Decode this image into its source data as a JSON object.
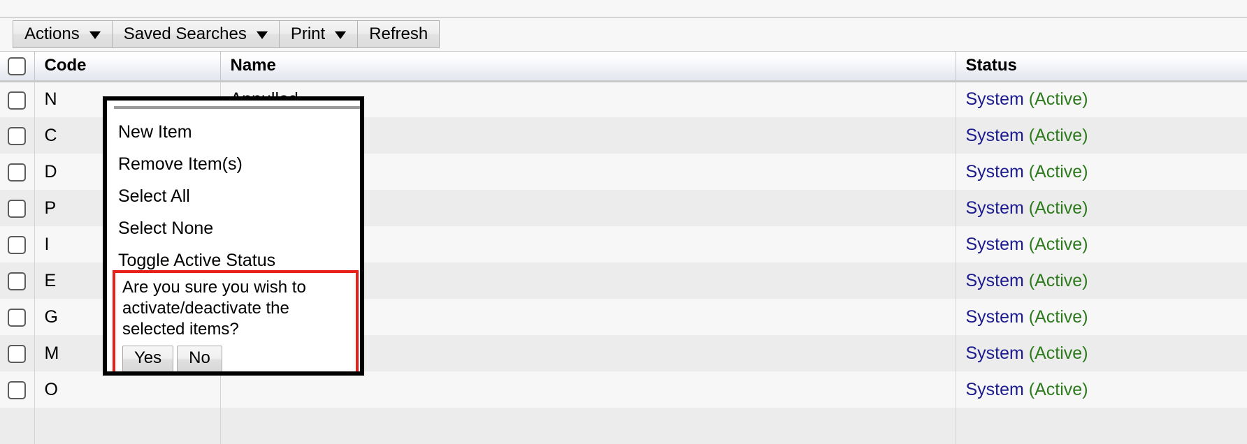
{
  "toolbar": {
    "buttons": [
      {
        "label": "Actions",
        "caret": true
      },
      {
        "label": "Saved Searches",
        "caret": true
      },
      {
        "label": "Print",
        "caret": true
      },
      {
        "label": "Refresh",
        "caret": false
      }
    ]
  },
  "table": {
    "columns": [
      "Code",
      "Name",
      "Status"
    ],
    "rows": [
      {
        "code": "N",
        "name": "Annulled",
        "status_system": "System",
        "status_state": "(Active)"
      },
      {
        "code": "C",
        "name": "",
        "status_system": "System",
        "status_state": "(Active)"
      },
      {
        "code": "D",
        "name": "",
        "status_system": "System",
        "status_state": "(Active)"
      },
      {
        "code": "P",
        "name": "",
        "status_system": "System",
        "status_state": "(Active)"
      },
      {
        "code": "I",
        "name": "",
        "status_system": "System",
        "status_state": "(Active)"
      },
      {
        "code": "E",
        "name": "",
        "status_system": "System",
        "status_state": "(Active)"
      },
      {
        "code": "G",
        "name": "",
        "status_system": "System",
        "status_state": "(Active)"
      },
      {
        "code": "M",
        "name": "",
        "status_system": "System",
        "status_state": "(Active)"
      },
      {
        "code": "O",
        "name": "",
        "status_system": "System",
        "status_state": "(Active)"
      },
      {
        "code": "",
        "name": "",
        "status_system": "",
        "status_state": ""
      }
    ]
  },
  "popup_menu": {
    "items": [
      "New Item",
      "Remove Item(s)",
      "Select All",
      "Select None",
      "Toggle Active Status"
    ]
  },
  "confirm_dialog": {
    "message": "Are you sure you wish to activate/deactivate the selected items?",
    "yes_label": "Yes",
    "no_label": "No",
    "border_color": "#e8201a"
  },
  "colors": {
    "status_system": "#1b1b8f",
    "status_active": "#2c7a1c",
    "row_odd": "#f7f7f7",
    "row_even": "#ececec"
  }
}
